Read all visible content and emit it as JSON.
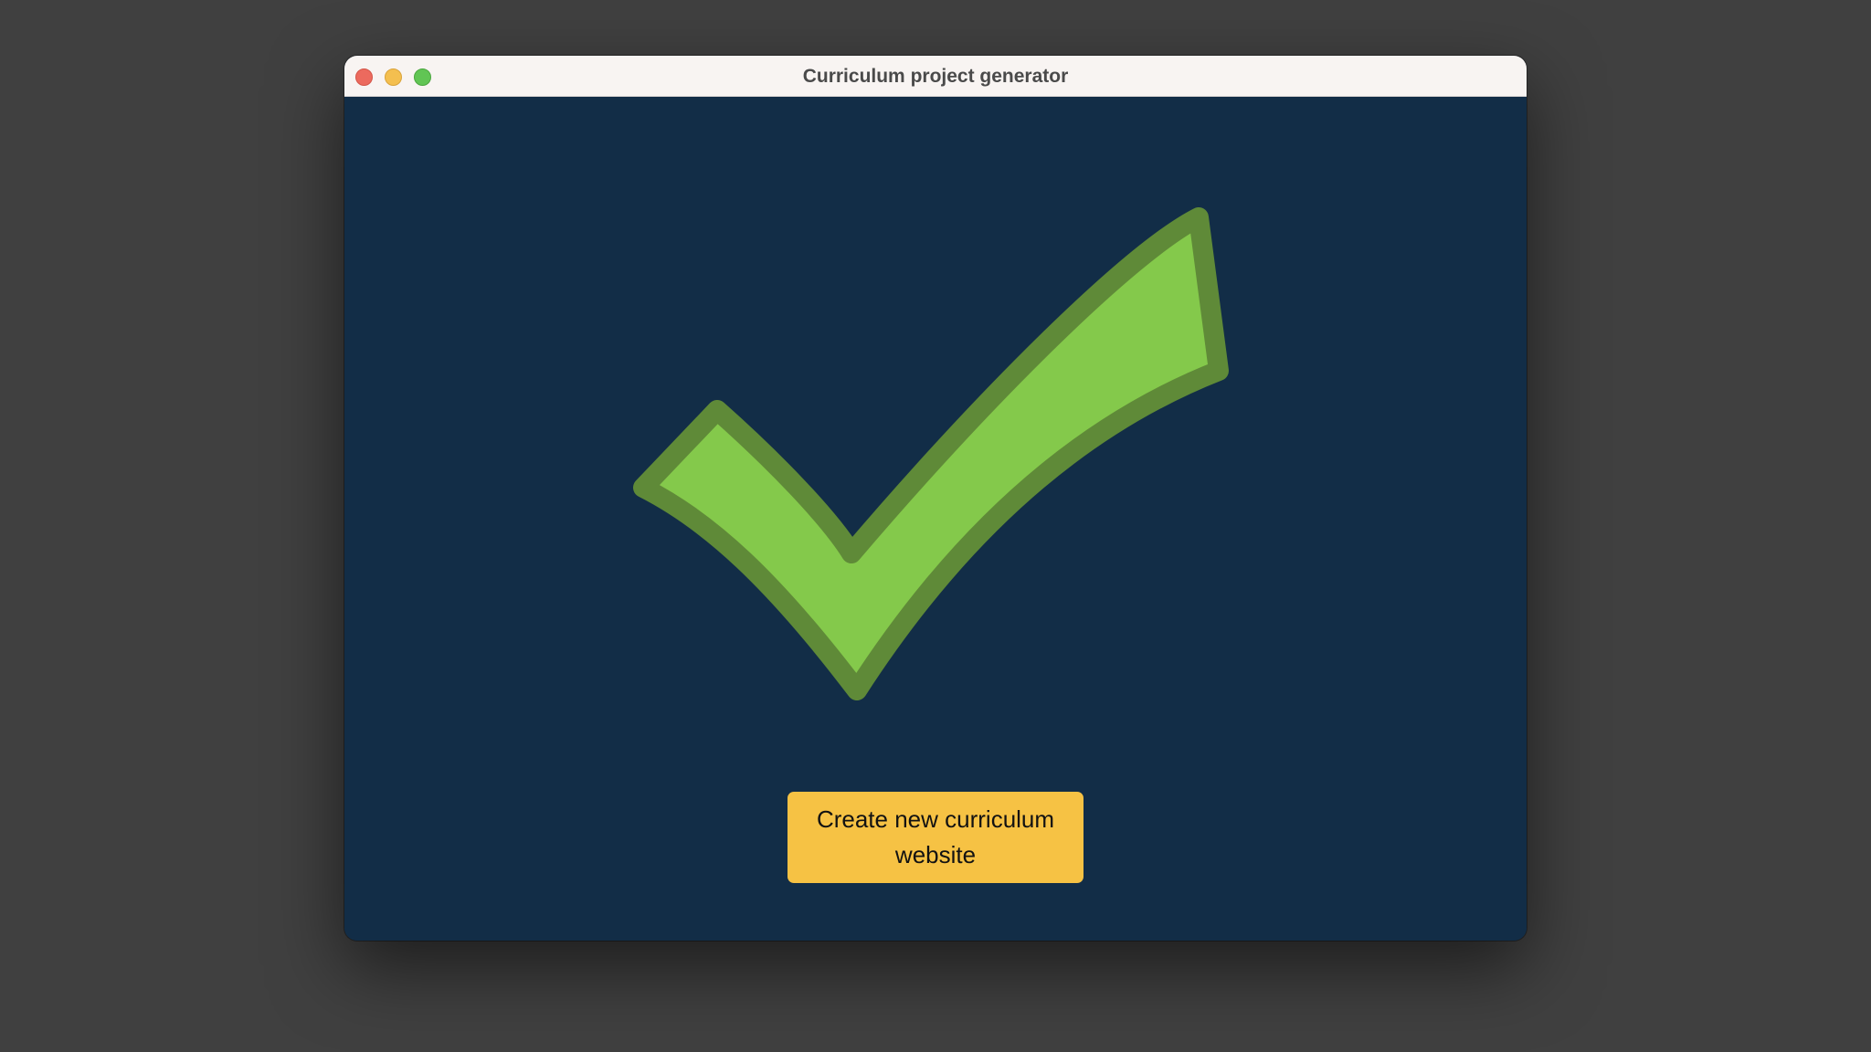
{
  "window": {
    "title": "Curriculum project generator"
  },
  "icons": {
    "success": "checkmark-icon"
  },
  "actions": {
    "create_label": "Create new curriculum website"
  },
  "colors": {
    "background": "#404040",
    "window_content": "#122d47",
    "titlebar": "#f8f4f2",
    "check_fill": "#84c94b",
    "check_stroke": "#5f8a38",
    "button": "#f6c244",
    "close": "#ec6a5e",
    "minimize": "#f4bf4f",
    "zoom": "#61c554"
  }
}
